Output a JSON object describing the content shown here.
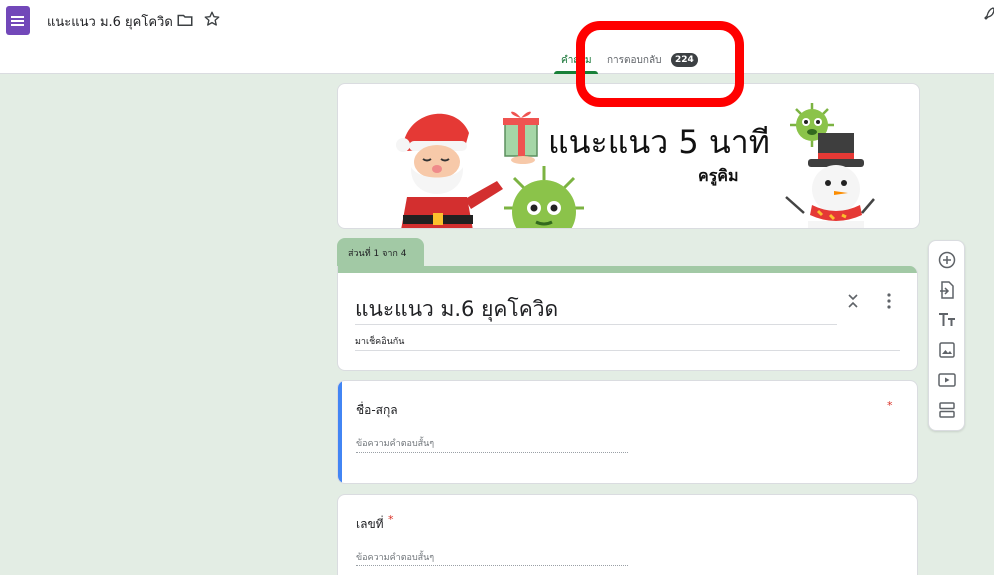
{
  "header": {
    "doc_title": "แนะแนว ม.6 ยุคโควิด",
    "tabs": [
      {
        "label": "คำถาม",
        "active": true
      },
      {
        "label": "การตอบกลับ",
        "active": false
      }
    ],
    "responses_count": "224"
  },
  "banner": {
    "title": "แนะแนว 5 นาที",
    "subtitle": "ครูคิม"
  },
  "section": {
    "label": "ส่วนที่ 1 จาก 4"
  },
  "form": {
    "title": "แนะแนว ม.6 ยุคโควิด",
    "description": "มาเช็คอินกัน"
  },
  "questions": [
    {
      "label": "ชื่อ-สกุล",
      "required_mark": "*",
      "placeholder": "ข้อความคำตอบสั้นๆ"
    },
    {
      "label": "เลขที่",
      "required_mark": "*",
      "placeholder": "ข้อความคำตอบสั้นๆ"
    }
  ],
  "toolbar": {
    "tools": [
      "add-question-icon",
      "import-questions-icon",
      "add-title-icon",
      "add-image-icon",
      "add-video-icon",
      "add-section-icon"
    ]
  },
  "colors": {
    "theme_green": "#a2c9a5",
    "background": "#e3ede4",
    "active_blue": "#4285f4",
    "highlight_red": "#ff0000",
    "forms_purple": "#7248b9",
    "required_red": "#d93025"
  }
}
